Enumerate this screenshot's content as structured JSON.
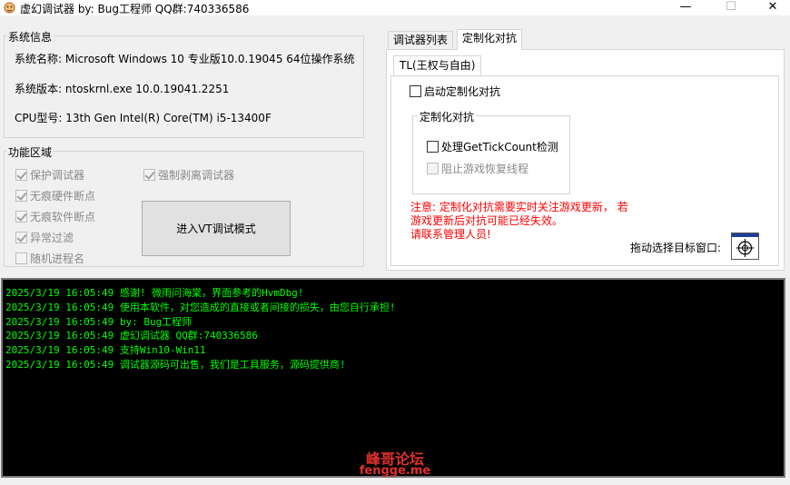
{
  "window": {
    "title": "虚幻调试器    by: Bug工程师    QQ群:740336586",
    "minimize_glyph": "—",
    "maximize_glyph": "☐",
    "close_glyph": "✕",
    "icon": "app-icon"
  },
  "system_info": {
    "legend": "系统信息",
    "os_name": "系统名称:  Microsoft Windows 10 专业版10.0.19045  64位操作系统",
    "os_version": "系统版本:  ntoskrnl.exe  10.0.19041.2251",
    "cpu": "CPU型号:  13th Gen Intel(R) Core(TM) i5-13400F"
  },
  "features": {
    "legend": "功能区域",
    "protect_debugger": {
      "label": "保护调试器",
      "checked": true
    },
    "stealth_hw_bp": {
      "label": "无痕硬件断点",
      "checked": true
    },
    "stealth_sw_bp": {
      "label": "无痕软件断点",
      "checked": true
    },
    "exception_filter": {
      "label": "异常过滤",
      "checked": true
    },
    "random_process_name": {
      "label": "随机进程名",
      "checked": false
    },
    "force_detach": {
      "label": "强制剥离调试器",
      "checked": true
    },
    "vt_button": "进入VT调试模式"
  },
  "tabs": [
    {
      "label": "调试器列表"
    },
    {
      "label": "定制化对抗"
    }
  ],
  "custom_panel": {
    "subtab": "TL(王权与自由)",
    "enable_label": "启动定制化对抗",
    "inner_legend": "定制化对抗",
    "handle_gettick": "处理GetTickCount检测",
    "block_thread_restore": "阻止游戏恢复线程",
    "note_line1": "注意: 定制化对抗需要实时关注游戏更新， 若",
    "note_line2": "游戏更新后对抗可能已经失效。",
    "note_line3": "请联系管理人员!",
    "drag_label": "拖动选择目标窗口:",
    "target_icon": "crosshair-target-icon"
  },
  "log": [
    "2025/3/19 16:05:49 感谢! 微雨问海棠，界面参考的HvmDbg!",
    "2025/3/19 16:05:49 使用本软件，对您造成的直接或者间接的损失，由您自行承担!",
    "2025/3/19 16:05:49 by: Bug工程师",
    "2025/3/19 16:05:49 虚幻调试器 QQ群:740336586",
    "2025/3/19 16:05:49 支持Win10-Win11",
    "2025/3/19 16:05:49 调试器源码可出售，我们是工具服务，源码提供商!"
  ],
  "watermark": {
    "line1": "峰哥论坛",
    "line2": "fengge.me"
  },
  "colors": {
    "log_text": "#00ff00",
    "note_text": "#ff0000",
    "watermark": "#e0302a"
  }
}
